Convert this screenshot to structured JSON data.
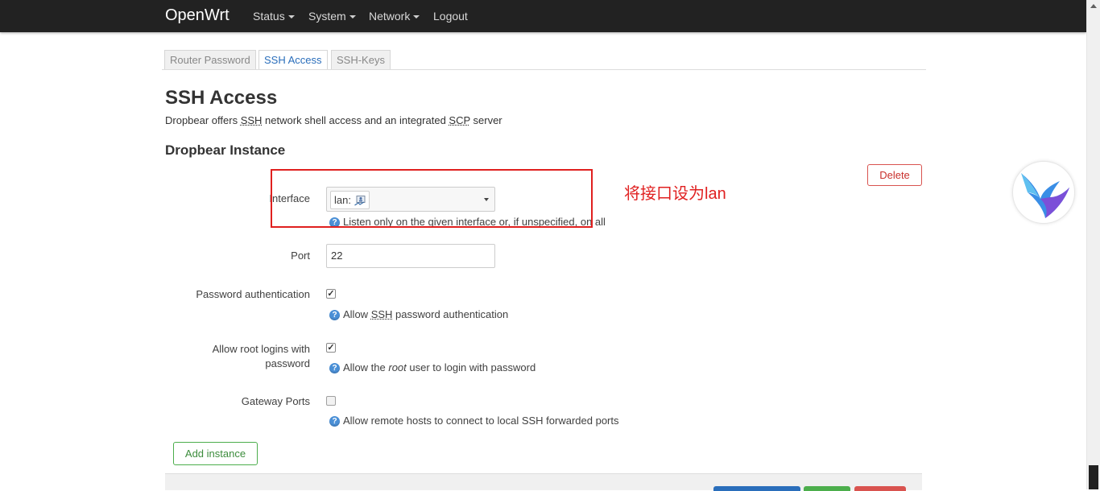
{
  "navbar": {
    "brand": "OpenWrt",
    "menus": [
      {
        "label": "Status"
      },
      {
        "label": "System"
      },
      {
        "label": "Network"
      }
    ],
    "logout": "Logout"
  },
  "tabs": [
    {
      "label": "Router Password",
      "active": false
    },
    {
      "label": "SSH Access",
      "active": true
    },
    {
      "label": "SSH-Keys",
      "active": false
    }
  ],
  "page": {
    "title": "SSH Access",
    "description_before": "Dropbear offers ",
    "abbr_ssh": "SSH",
    "description_middle": " network shell access and an integrated ",
    "abbr_scp": "SCP",
    "description_after": " server"
  },
  "section": {
    "title": "Dropbear Instance",
    "delete_label": "Delete"
  },
  "fields": {
    "interface": {
      "label": "Interface",
      "value": "lan:",
      "icon": "network-interface-icon",
      "help": "Listen only on the given interface or, if unspecified, on all"
    },
    "port": {
      "label": "Port",
      "value": "22"
    },
    "password_auth": {
      "label": "Password authentication",
      "checked": true,
      "help_before": "Allow ",
      "help_abbr": "SSH",
      "help_after": " password authentication"
    },
    "root_login": {
      "label_line1": "Allow root logins with",
      "label_line2": "password",
      "checked": true,
      "help_before": "Allow the ",
      "help_em": "root",
      "help_after": " user to login with password"
    },
    "gateway_ports": {
      "label": "Gateway Ports",
      "checked": false,
      "help": "Allow remote hosts to connect to local SSH forwarded ports"
    }
  },
  "add_instance_label": "Add instance",
  "annotation": {
    "text": "将接口设为lan",
    "color": "#e02020"
  },
  "colors": {
    "navbar_bg": "#222222",
    "link_blue": "#2a6ebb",
    "danger": "#d9534f",
    "success": "#4cae4c"
  }
}
